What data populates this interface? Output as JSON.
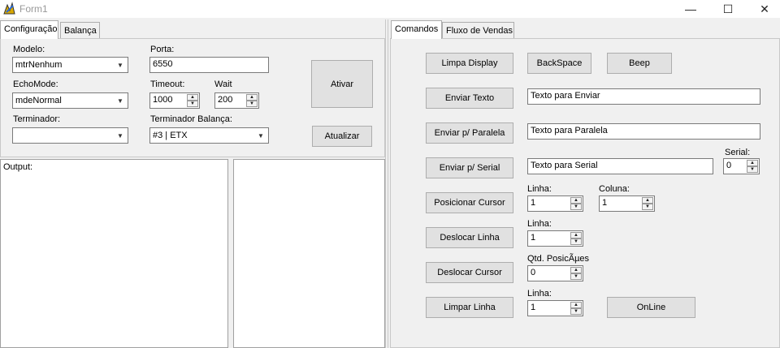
{
  "window": {
    "title": "Form1",
    "controls": {
      "minimize": "—",
      "maximize": "☐",
      "close": "✕"
    }
  },
  "left_tabs": [
    {
      "label": "Configuração"
    },
    {
      "label": "Balança"
    }
  ],
  "config": {
    "modelo": {
      "label": "Modelo:",
      "value": "mtrNenhum"
    },
    "porta": {
      "label": "Porta:",
      "value": "6550"
    },
    "echomode": {
      "label": "EchoMode:",
      "value": "mdeNormal"
    },
    "timeout": {
      "label": "Timeout:",
      "value": "1000"
    },
    "wait": {
      "label": "Wait",
      "value": "200"
    },
    "terminador": {
      "label": "Terminador:",
      "value": ""
    },
    "terminador_balanca": {
      "label": "Terminador Balança:",
      "value": "#3 | ETX"
    },
    "ativar_button": "Ativar",
    "atualizar_button": "Atualizar"
  },
  "output": {
    "label": "Output:"
  },
  "right_tabs": [
    {
      "label": "Comandos"
    },
    {
      "label": "Fluxo de Vendas"
    }
  ],
  "commands": {
    "limpa_display": "Limpa Display",
    "backspace": "BackSpace",
    "beep": "Beep",
    "enviar_texto": {
      "button": "Enviar Texto",
      "value": "Texto para Enviar"
    },
    "enviar_paralela": {
      "button": "Enviar p/ Paralela",
      "value": "Texto para Paralela"
    },
    "enviar_serial": {
      "button": "Enviar p/ Serial",
      "value": "Texto para Serial",
      "serial_label": "Serial:",
      "serial_value": "0"
    },
    "posicionar_cursor": {
      "button": "Posicionar Cursor",
      "linha_label": "Linha:",
      "linha_value": "1",
      "coluna_label": "Coluna:",
      "coluna_value": "1"
    },
    "deslocar_linha": {
      "button": "Deslocar Linha",
      "linha_label": "Linha:",
      "linha_value": "1"
    },
    "deslocar_cursor": {
      "button": "Deslocar Cursor",
      "qtd_label": "Qtd. PosicÃµes",
      "qtd_value": "0"
    },
    "limpar_linha": {
      "button": "Limpar Linha",
      "linha_label": "Linha:",
      "linha_value": "1"
    },
    "online": "OnLine"
  }
}
